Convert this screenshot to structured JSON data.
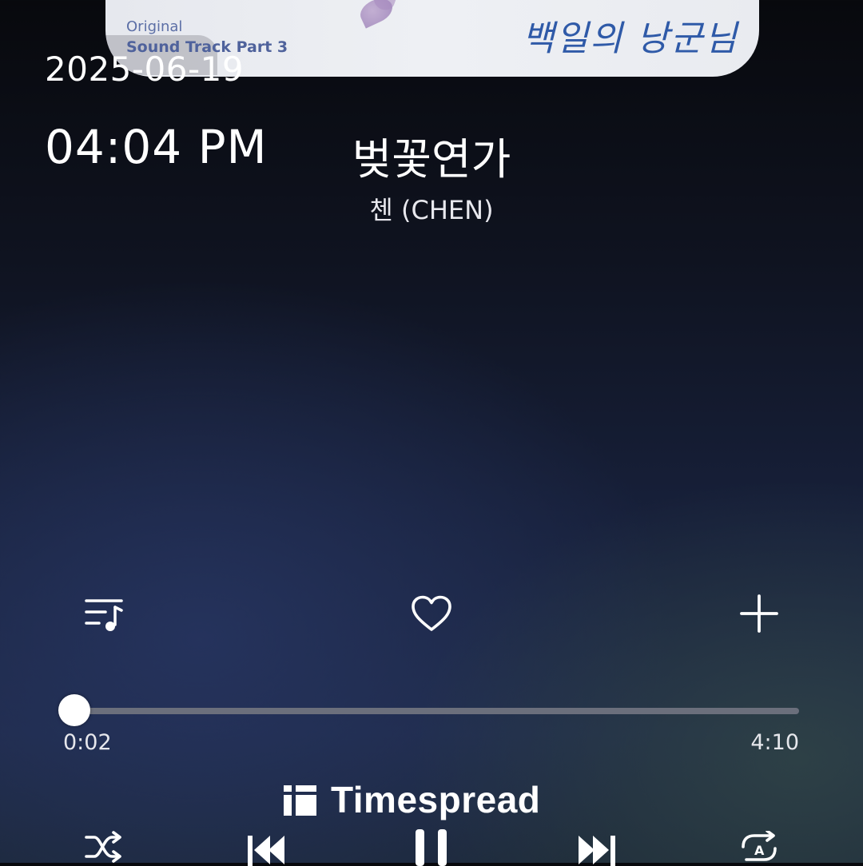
{
  "album": {
    "line1": "Original",
    "line2": "Sound Track Part 3",
    "title_art": "백일의 낭군님"
  },
  "status": {
    "date": "2025-06-19",
    "time": "04:04 PM"
  },
  "track": {
    "title": "벚꽃연가",
    "artist": "첸 (CHEN)"
  },
  "actions": {
    "queue_icon": "playlist-music-icon",
    "like_icon": "heart-outline-icon",
    "add_icon": "plus-icon"
  },
  "playback": {
    "elapsed": "0:02",
    "duration": "4:10",
    "progress_fraction": 0.008
  },
  "controls": {
    "shuffle_icon": "shuffle-icon",
    "previous_icon": "skip-previous-icon",
    "play_pause_icon": "pause-icon",
    "next_icon": "skip-next-icon",
    "repeat_icon": "repeat-auto-icon"
  },
  "watermark": {
    "text": "Timespread"
  },
  "colors": {
    "accent": "#ffffff",
    "track_bg": "#6b6f7c",
    "calligraphy": "#2f5aa8"
  }
}
